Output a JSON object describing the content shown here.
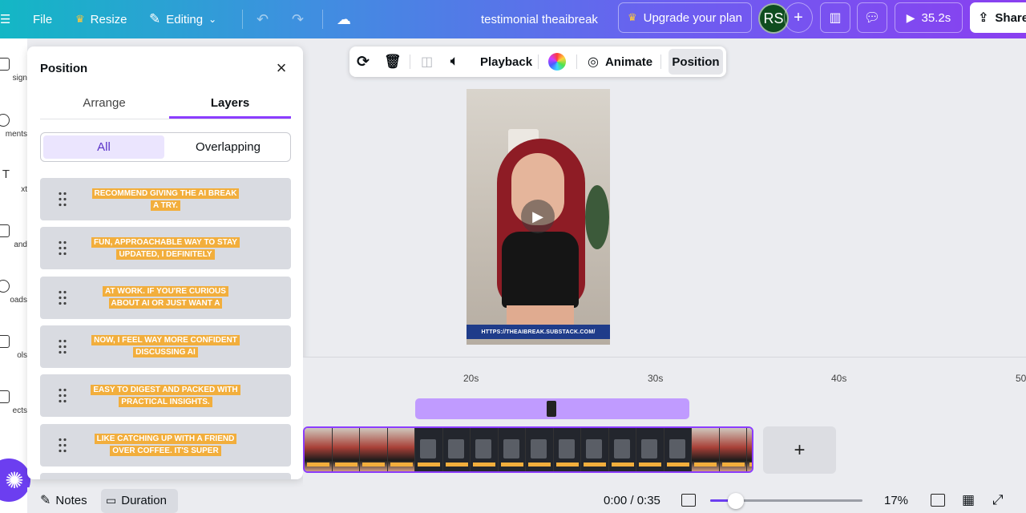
{
  "topbar": {
    "file": "File",
    "resize": "Resize",
    "editing": "Editing",
    "doc_title": "testimonial theaibreak",
    "upgrade": "Upgrade your plan",
    "avatar_initials": "RS",
    "play_time": "35.2s",
    "share": "Share"
  },
  "rail": {
    "items": [
      "sign",
      "ments",
      "xt",
      "and",
      "oads",
      "ols",
      "ects"
    ]
  },
  "panel": {
    "title": "Position",
    "tabs": [
      "Arrange",
      "Layers"
    ],
    "active_tab": "Layers",
    "filters": [
      "All",
      "Overlapping"
    ],
    "active_filter": "All",
    "layers": [
      "RECOMMEND GIVING THE AI BREAK A TRY.",
      "FUN, APPROACHABLE WAY TO STAY UPDATED, I DEFINITELY",
      "AT WORK. IF YOU'RE CURIOUS ABOUT AI OR JUST WANT A",
      "NOW, I FEEL WAY MORE CONFIDENT DISCUSSING AI",
      "EASY TO DIGEST AND PACKED WITH PRACTICAL INSIGHTS.",
      "LIKE CATCHING UP WITH A FRIEND OVER COFFEE. IT'S SUPER"
    ]
  },
  "toolbar": {
    "playback": "Playback",
    "animate": "Animate",
    "position": "Position"
  },
  "preview": {
    "url_text": "HTTPS://THEAIBREAK.SUBSTACK.COM/"
  },
  "timeline": {
    "ticks": [
      "20s",
      "30s",
      "40s",
      "50"
    ],
    "add_label": "+"
  },
  "bottombar": {
    "notes": "Notes",
    "duration": "Duration",
    "time": "0:00 / 0:35",
    "zoom": "17%",
    "zoom_fraction": 0.17
  },
  "colors": {
    "accent": "#8b3dff",
    "caption_highlight": "#f2ae3c",
    "layer_bg": "#d9dbe1"
  }
}
